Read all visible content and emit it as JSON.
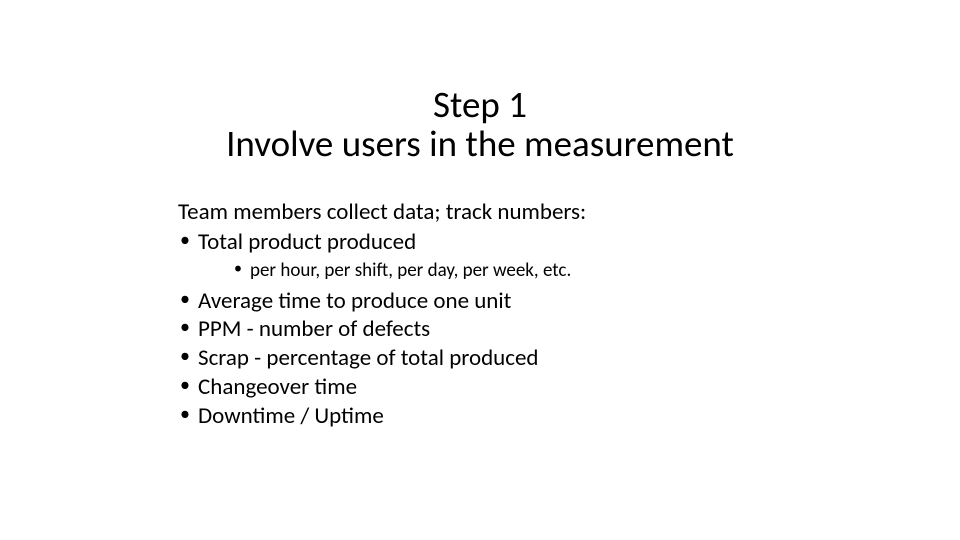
{
  "title": {
    "line1": "Step   1",
    "line2": "Involve users in the measurement"
  },
  "body": {
    "intro": "Team members collect data; track  numbers:",
    "items": [
      "Total product produced",
      "Average time to produce one unit",
      "PPM - number of defects",
      "Scrap - percentage of total produced",
      "Changeover time",
      "Downtime / Uptime"
    ],
    "sub_items_0": [
      "per hour, per shift, per day, per week, etc."
    ]
  }
}
